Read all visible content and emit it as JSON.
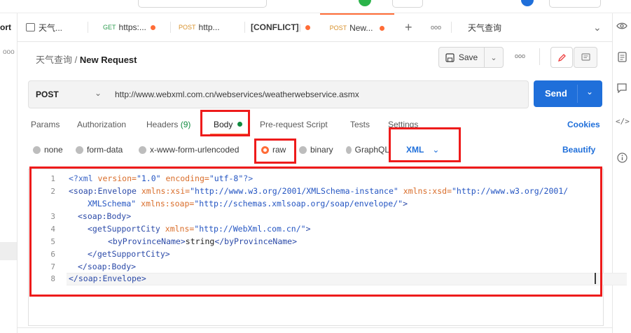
{
  "sidebar": {
    "label_fragment": "ort",
    "more": "ooo"
  },
  "tabs": [
    {
      "method": "",
      "label": "天气...",
      "dirty": false,
      "icon": "request-tab-icon"
    },
    {
      "method": "GET",
      "label": "https:...",
      "dirty": true
    },
    {
      "method": "POST",
      "label": "http...",
      "dirty": false
    },
    {
      "method": "",
      "label": "[CONFLICT] ",
      "dirty": true
    },
    {
      "method": "POST",
      "label": "New...",
      "dirty": true,
      "active": true
    }
  ],
  "tab_controls": {
    "new": "+",
    "more": "ooo",
    "env_label": "天气查询",
    "dropdown": "⌄"
  },
  "breadcrumb": {
    "parent": "天气查询",
    "separator": " / ",
    "current": "New Request"
  },
  "toolbar": {
    "save_label": "Save",
    "more": "ooo"
  },
  "request": {
    "method": "POST",
    "url": "http://www.webxml.com.cn/webservices/weatherwebservice.asmx",
    "send_label": "Send"
  },
  "request_tabs": {
    "params": "Params",
    "authorization": "Authorization",
    "headers": "Headers",
    "headers_count": "(9)",
    "body": "Body",
    "prerequest": "Pre-request Script",
    "tests": "Tests",
    "settings": "Settings",
    "cookies": "Cookies"
  },
  "body_types": {
    "none": "none",
    "form_data": "form-data",
    "urlencoded": "x-www-form-urlencoded",
    "raw": "raw",
    "binary": "binary",
    "graphql": "GraphQL",
    "format": "XML",
    "beautify": "Beautify"
  },
  "editor": {
    "line_numbers": [
      "1",
      "2",
      "",
      "3",
      "4",
      "5",
      "6",
      "7",
      "8"
    ],
    "lines": [
      {
        "t1": "<?xml",
        "a1": " version=",
        "v1": "\"1.0\"",
        "a2": " encoding=",
        "v2": "\"utf-8\"",
        "t2": "?>"
      },
      {
        "t1": "<soap:Envelope",
        "a1": " xmlns:xsi=",
        "v1": "\"http://www.w3.org/2001/XMLSchema-instance\"",
        "a2": " xmlns:xsd=",
        "v2": "\"http://www.w3.org/2001/"
      },
      {
        "v1": "XMLSchema\"",
        "a1": " xmlns:soap=",
        "v2": "\"http://schemas.xmlsoap.org/soap/envelope/\"",
        "t2": ">"
      },
      {
        "t1": "<soap:Body>"
      },
      {
        "t1": "<getSupportCity",
        "a1": " xmlns=",
        "v1": "\"http://WebXml.com.cn/\"",
        "t2": ">"
      },
      {
        "t1": "<byProvinceName>",
        "text": "string",
        "t2": "</byProvinceName>"
      },
      {
        "t1": "</getSupportCity>"
      },
      {
        "t1": "</soap:Body>"
      },
      {
        "t1": "</soap:Envelope>"
      }
    ]
  },
  "colors": {
    "accent": "#ff6c37",
    "send": "#1f6fda",
    "annotation": "#ee1b1b",
    "body_dot": "#0f8a3f"
  }
}
